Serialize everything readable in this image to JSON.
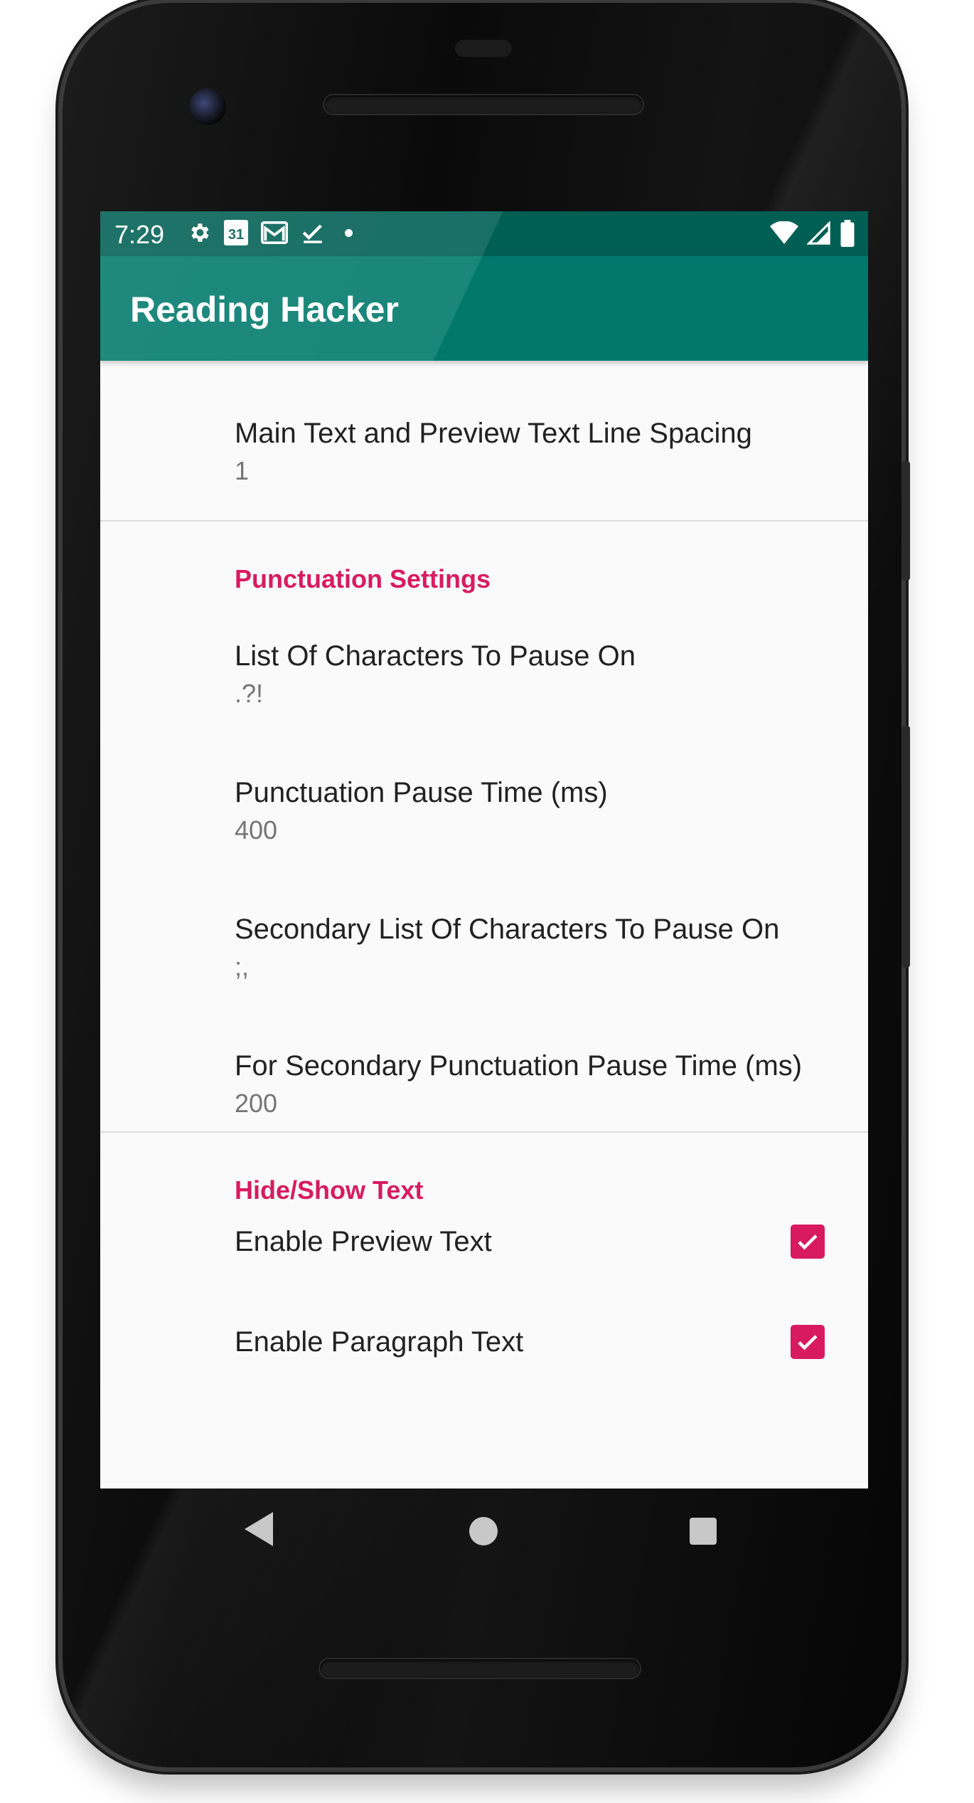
{
  "status_bar": {
    "time": "7:29",
    "left_icons": [
      "settings-icon",
      "calendar-icon",
      "gmail-icon",
      "checkmark-icon",
      "dot-icon"
    ],
    "calendar_day": "31",
    "right_icons": [
      "wifi-icon",
      "signal-icon",
      "battery-icon"
    ]
  },
  "app_bar": {
    "title": "Reading Hacker",
    "color": "#00796b"
  },
  "preferences": {
    "line_spacing": {
      "title": "Main Text and Preview Text Line Spacing",
      "summary": "1"
    },
    "punctuation": {
      "category": "Punctuation Settings",
      "items": [
        {
          "title": "List Of Characters To Pause On",
          "summary": ".?!"
        },
        {
          "title": "Punctuation Pause Time (ms)",
          "summary": "400"
        },
        {
          "title": "Secondary List Of Characters To Pause On",
          "summary": ";,"
        },
        {
          "title": "For Secondary Punctuation Pause Time (ms)",
          "summary": "200"
        }
      ]
    },
    "hide_show": {
      "category": "Hide/Show Text",
      "items": [
        {
          "title": "Enable Preview Text",
          "checked": true
        },
        {
          "title": "Enable Paragraph Text",
          "checked": true
        }
      ]
    }
  },
  "accent_color": "#d81b60",
  "nav_bar": {
    "icons": [
      "back-icon",
      "home-icon",
      "recents-icon"
    ]
  }
}
